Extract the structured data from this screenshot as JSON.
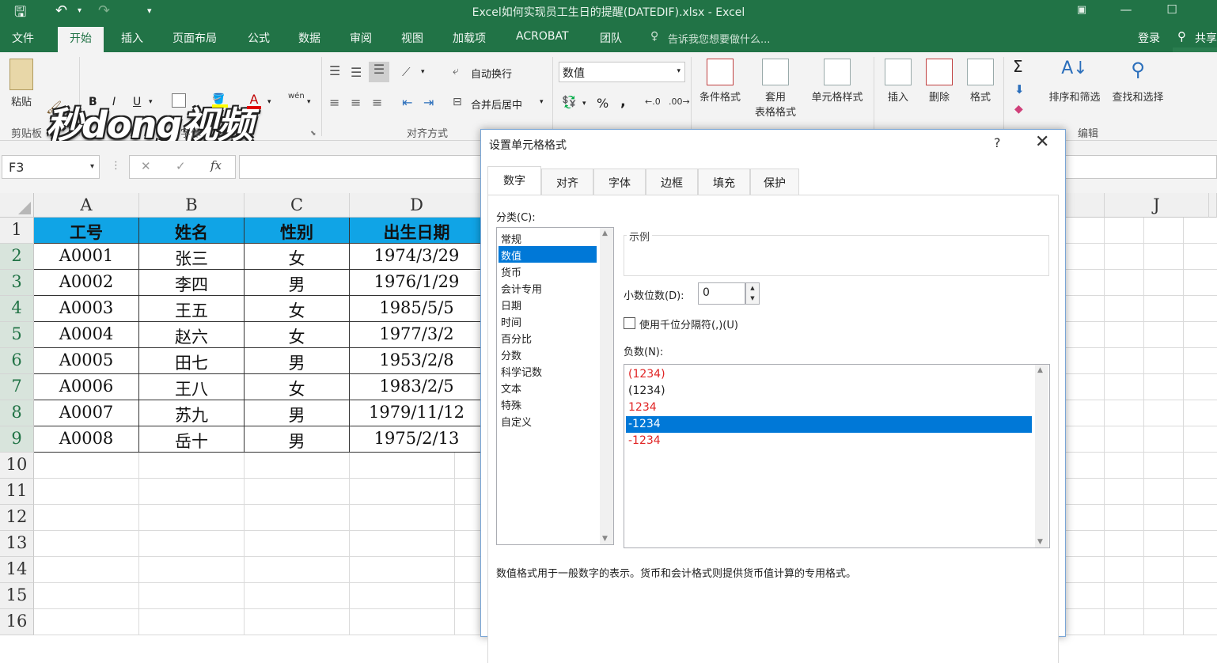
{
  "window": {
    "title": "Excel如何实现员工生日的提醒(DATEDIF).xlsx - Excel"
  },
  "ribbon_tabs": [
    "文件",
    "开始",
    "插入",
    "页面布局",
    "公式",
    "数据",
    "审阅",
    "视图",
    "加载项",
    "ACROBAT",
    "团队"
  ],
  "tell_me": "告诉我您想要做什么...",
  "account": {
    "login": "登录",
    "share": "共享"
  },
  "watermark": "秒dong视频",
  "ribbon": {
    "clipboard": {
      "paste": "粘贴",
      "label": "剪贴板"
    },
    "font": {
      "label": "字体",
      "bold": "B",
      "italic": "I",
      "underline": "U",
      "font_color": "A",
      "phonetic": "wén"
    },
    "alignment": {
      "label": "对齐方式",
      "wrap": "自动换行",
      "merge": "合并后居中"
    },
    "number": {
      "format_value": "数值",
      "percent": "%",
      "comma": ","
    },
    "styles": {
      "conditional": "条件格式",
      "table_format_1": "套用",
      "table_format_2": "表格格式",
      "cell_styles": "单元格样式"
    },
    "cells": {
      "insert": "插入",
      "delete": "删除",
      "format": "格式"
    },
    "editing": {
      "label": "编辑",
      "sort_filter": "排序和筛选",
      "find_select": "查找和选择",
      "sigma": "Σ"
    }
  },
  "formula_bar": {
    "name_box": "F3",
    "fx": "fx",
    "cancel": "✕",
    "enter": "✓"
  },
  "columns": [
    "A",
    "B",
    "C",
    "D",
    "J"
  ],
  "rows": [
    "1",
    "2",
    "3",
    "4",
    "5",
    "6",
    "7",
    "8",
    "9",
    "10",
    "11",
    "12",
    "13",
    "14",
    "15",
    "16"
  ],
  "table": {
    "headers": [
      "工号",
      "姓名",
      "性别",
      "出生日期"
    ],
    "rows": [
      [
        "A0001",
        "张三",
        "女",
        "1974/3/29"
      ],
      [
        "A0002",
        "李四",
        "男",
        "1976/1/29"
      ],
      [
        "A0003",
        "王五",
        "女",
        "1985/5/5"
      ],
      [
        "A0004",
        "赵六",
        "女",
        "1977/3/2"
      ],
      [
        "A0005",
        "田七",
        "男",
        "1953/2/8"
      ],
      [
        "A0006",
        "王八",
        "女",
        "1983/2/5"
      ],
      [
        "A0007",
        "苏九",
        "男",
        "1979/11/12"
      ],
      [
        "A0008",
        "岳十",
        "男",
        "1975/2/13"
      ]
    ]
  },
  "dialog": {
    "title": "设置单元格格式",
    "help": "?",
    "close": "✕",
    "tabs": [
      "数字",
      "对齐",
      "字体",
      "边框",
      "填充",
      "保护"
    ],
    "category_label": "分类(C):",
    "categories": [
      "常规",
      "数值",
      "货币",
      "会计专用",
      "日期",
      "时间",
      "百分比",
      "分数",
      "科学记数",
      "文本",
      "特殊",
      "自定义"
    ],
    "selected_category": "数值",
    "sample_label": "示例",
    "decimal_label": "小数位数(D):",
    "decimal_value": "0",
    "thousand_label": "使用千位分隔符(,)(U)",
    "negative_label": "负数(N):",
    "negatives": [
      "(1234)",
      "(1234)",
      "1234",
      "-1234",
      "-1234"
    ],
    "description": "数值格式用于一般数字的表示。货币和会计格式则提供货币值计算的专用格式。"
  }
}
